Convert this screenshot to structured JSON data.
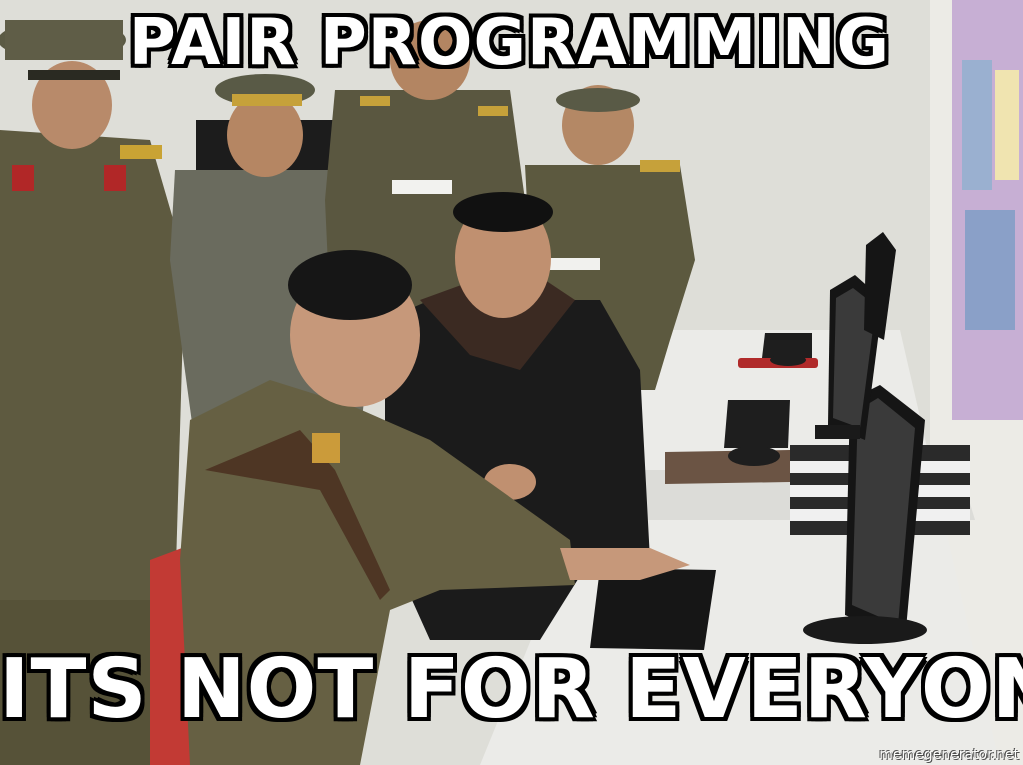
{
  "meme": {
    "top_text": "PAIR PROGRAMMING",
    "bottom_text": "ITS NOT FOR EVERYONE",
    "watermark": "memegenerator.net"
  },
  "colors": {
    "wall": "#e4e4df",
    "uniform": "#5f5a3f",
    "black_coat": "#1b1b1b",
    "desk": "#e9e9e6",
    "monitor": "#1a1a1a",
    "poster": "#c9b3d6"
  }
}
